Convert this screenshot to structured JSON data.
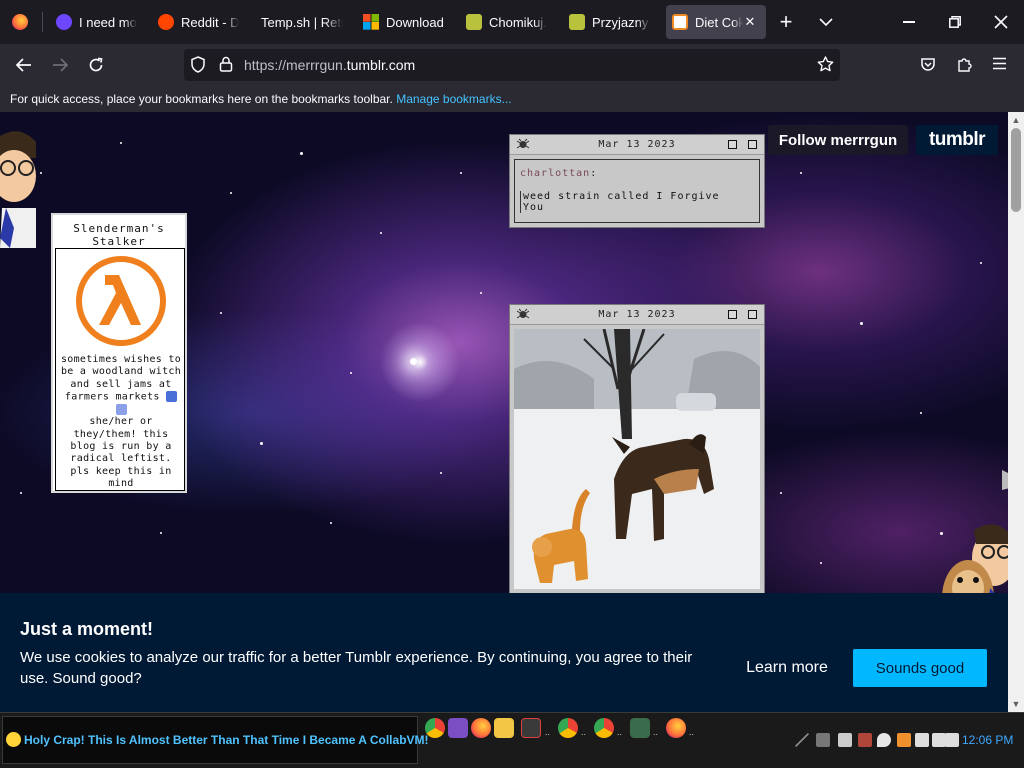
{
  "browser": {
    "tabs": [
      {
        "label": "",
        "favicon": "firefox-icon",
        "color": "#ff7139"
      },
      {
        "label": "I need mo",
        "favicon": "openai-icon",
        "color": "#6c47ff"
      },
      {
        "label": "Reddit - Di",
        "favicon": "reddit-icon",
        "color": "#ff4500"
      },
      {
        "label": "Temp.sh | Retr",
        "favicon": "",
        "color": ""
      },
      {
        "label": "Download",
        "favicon": "windows-icon",
        "color": "#00a4ef"
      },
      {
        "label": "Chomikuj.p",
        "favicon": "chomikuj-icon",
        "color": "#b8c23c"
      },
      {
        "label": "Przyjazny d",
        "favicon": "page-icon",
        "color": "#b8c23c"
      },
      {
        "label": "Diet Cok",
        "favicon": "halflife-icon",
        "color": "#f08a24",
        "active": true
      }
    ],
    "url_prefix": "https://merrrgun.",
    "url_domain": "tumblr.com",
    "bookmark_message": "For quick access, place your bookmarks here on the bookmarks toolbar.",
    "bookmark_link": "Manage bookmarks..."
  },
  "tumblr": {
    "follow_label": "Follow merrrgun",
    "logo_text": "tumblr",
    "profile": {
      "name": "Slenderman's Stalker",
      "description_1": "sometimes wishes to be a woodland witch and sell jams at farmers markets",
      "description_2": "she/her or they/them! this blog is run by a radical leftist. pls keep this in mind"
    },
    "posts": [
      {
        "date": "Mar 13 2023",
        "author": "charlottan",
        "body": "weed strain called I Forgive You"
      },
      {
        "date": "Mar 13 2023",
        "media": "photo of a dog and a cat playing in snow"
      }
    ]
  },
  "cookie": {
    "title": "Just a moment!",
    "text": "We use cookies to analyze our traffic for a better Tumblr experience. By continuing, you agree to their use. Sound good?",
    "learn_more": "Learn more",
    "accept": "Sounds good"
  },
  "taskbar": {
    "marquee": "Holy Crap! This Is Almost Better Than That Time I Became A CollabVM!",
    "clock": "12:06 PM"
  },
  "colors": {
    "tumblr_navy": "#001935",
    "accept_blue": "#00b8ff",
    "link_blue": "#45c3ff"
  }
}
